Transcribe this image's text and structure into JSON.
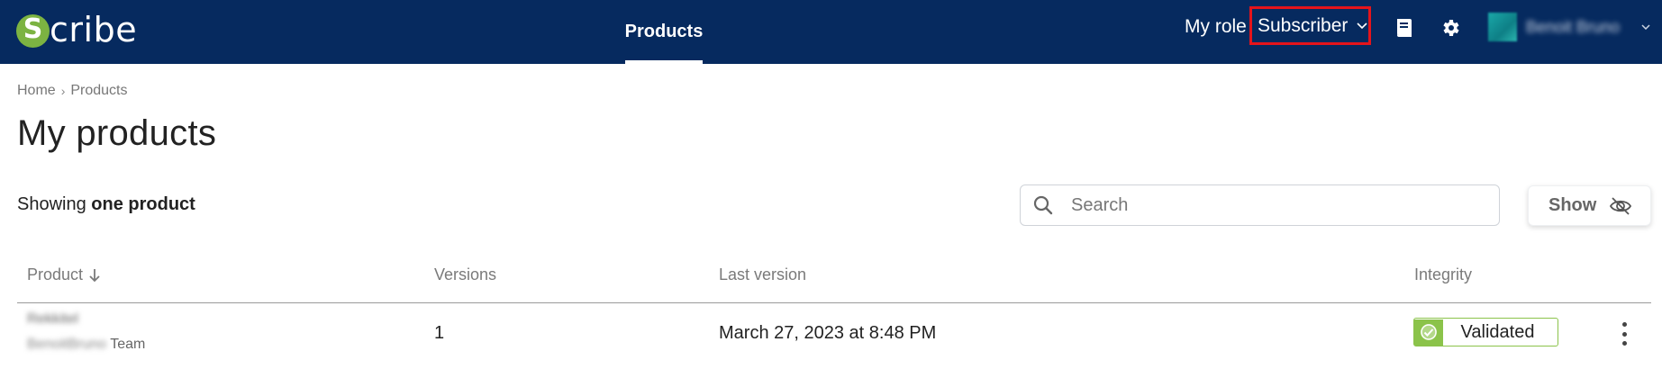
{
  "header": {
    "logo_letter": "S",
    "logo_text": "cribe",
    "nav_tab": "Products",
    "role_label": "My role",
    "role_value": "Subscriber",
    "user_name": "Benoit Bruno",
    "colors": {
      "header_bg": "#062a5f",
      "accent_green": "#7cb342",
      "highlight_red": "#e5141b"
    }
  },
  "breadcrumb": {
    "home": "Home",
    "current": "Products"
  },
  "page": {
    "title": "My products"
  },
  "toolbar": {
    "showing_prefix": "Showing",
    "showing_count": "one product",
    "search_placeholder": "Search",
    "show_label": "Show"
  },
  "table": {
    "columns": [
      "Product",
      "Versions",
      "Last version",
      "Integrity"
    ],
    "rows": [
      {
        "product_name": "Rekkitel",
        "owner_name": "BenoitBruno",
        "owner_suffix": "Team",
        "versions": "1",
        "last_version": "March 27, 2023 at 8:48 PM",
        "integrity": "Validated"
      }
    ]
  }
}
